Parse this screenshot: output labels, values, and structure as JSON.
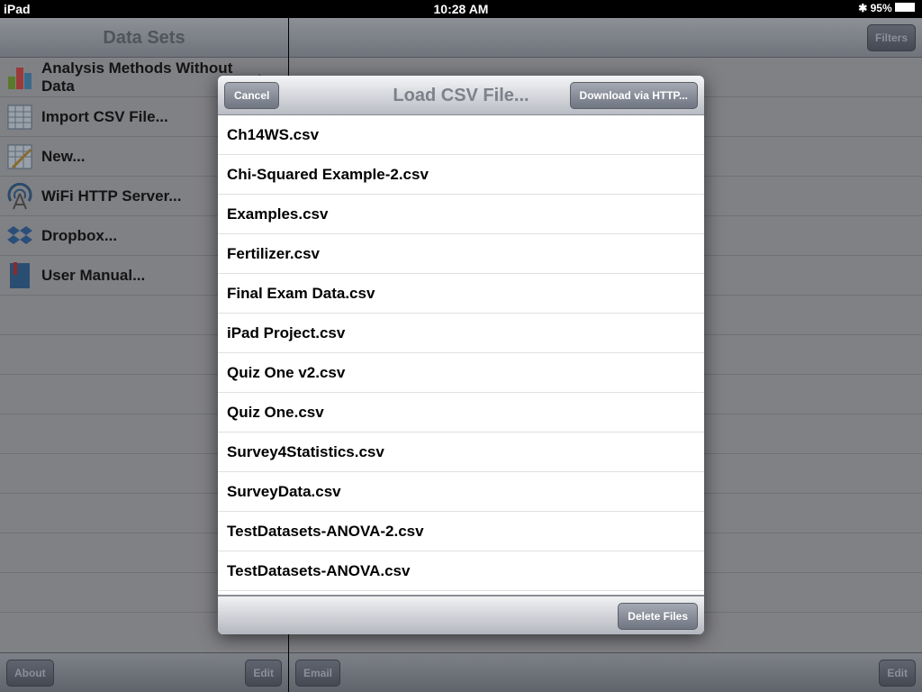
{
  "status": {
    "device": "iPad",
    "time": "10:28 AM",
    "battery": "95%"
  },
  "left": {
    "title": "Data Sets",
    "items": [
      {
        "label": "Analysis Methods Without Data",
        "icon": "bar-chart-icon"
      },
      {
        "label": "Import CSV File...",
        "icon": "spreadsheet-icon"
      },
      {
        "label": "New...",
        "icon": "spreadsheet-pencil-icon"
      },
      {
        "label": "WiFi HTTP Server...",
        "icon": "wifi-tower-icon"
      },
      {
        "label": "Dropbox...",
        "icon": "dropbox-icon"
      },
      {
        "label": "User Manual...",
        "icon": "book-icon"
      }
    ],
    "about": "About",
    "edit": "Edit"
  },
  "right": {
    "filters": "Filters",
    "email": "Email",
    "edit": "Edit"
  },
  "modal": {
    "title": "Load CSV File...",
    "cancel": "Cancel",
    "download": "Download via HTTP...",
    "delete": "Delete Files",
    "files": [
      "Ch14WS.csv",
      "Chi-Squared Example-2.csv",
      "Examples.csv",
      "Fertilizer.csv",
      "Final Exam Data.csv",
      "iPad Project.csv",
      "Quiz One v2.csv",
      "Quiz One.csv",
      "Survey4Statistics.csv",
      "SurveyData.csv",
      "TestDatasets-ANOVA-2.csv",
      "TestDatasets-ANOVA.csv"
    ]
  }
}
